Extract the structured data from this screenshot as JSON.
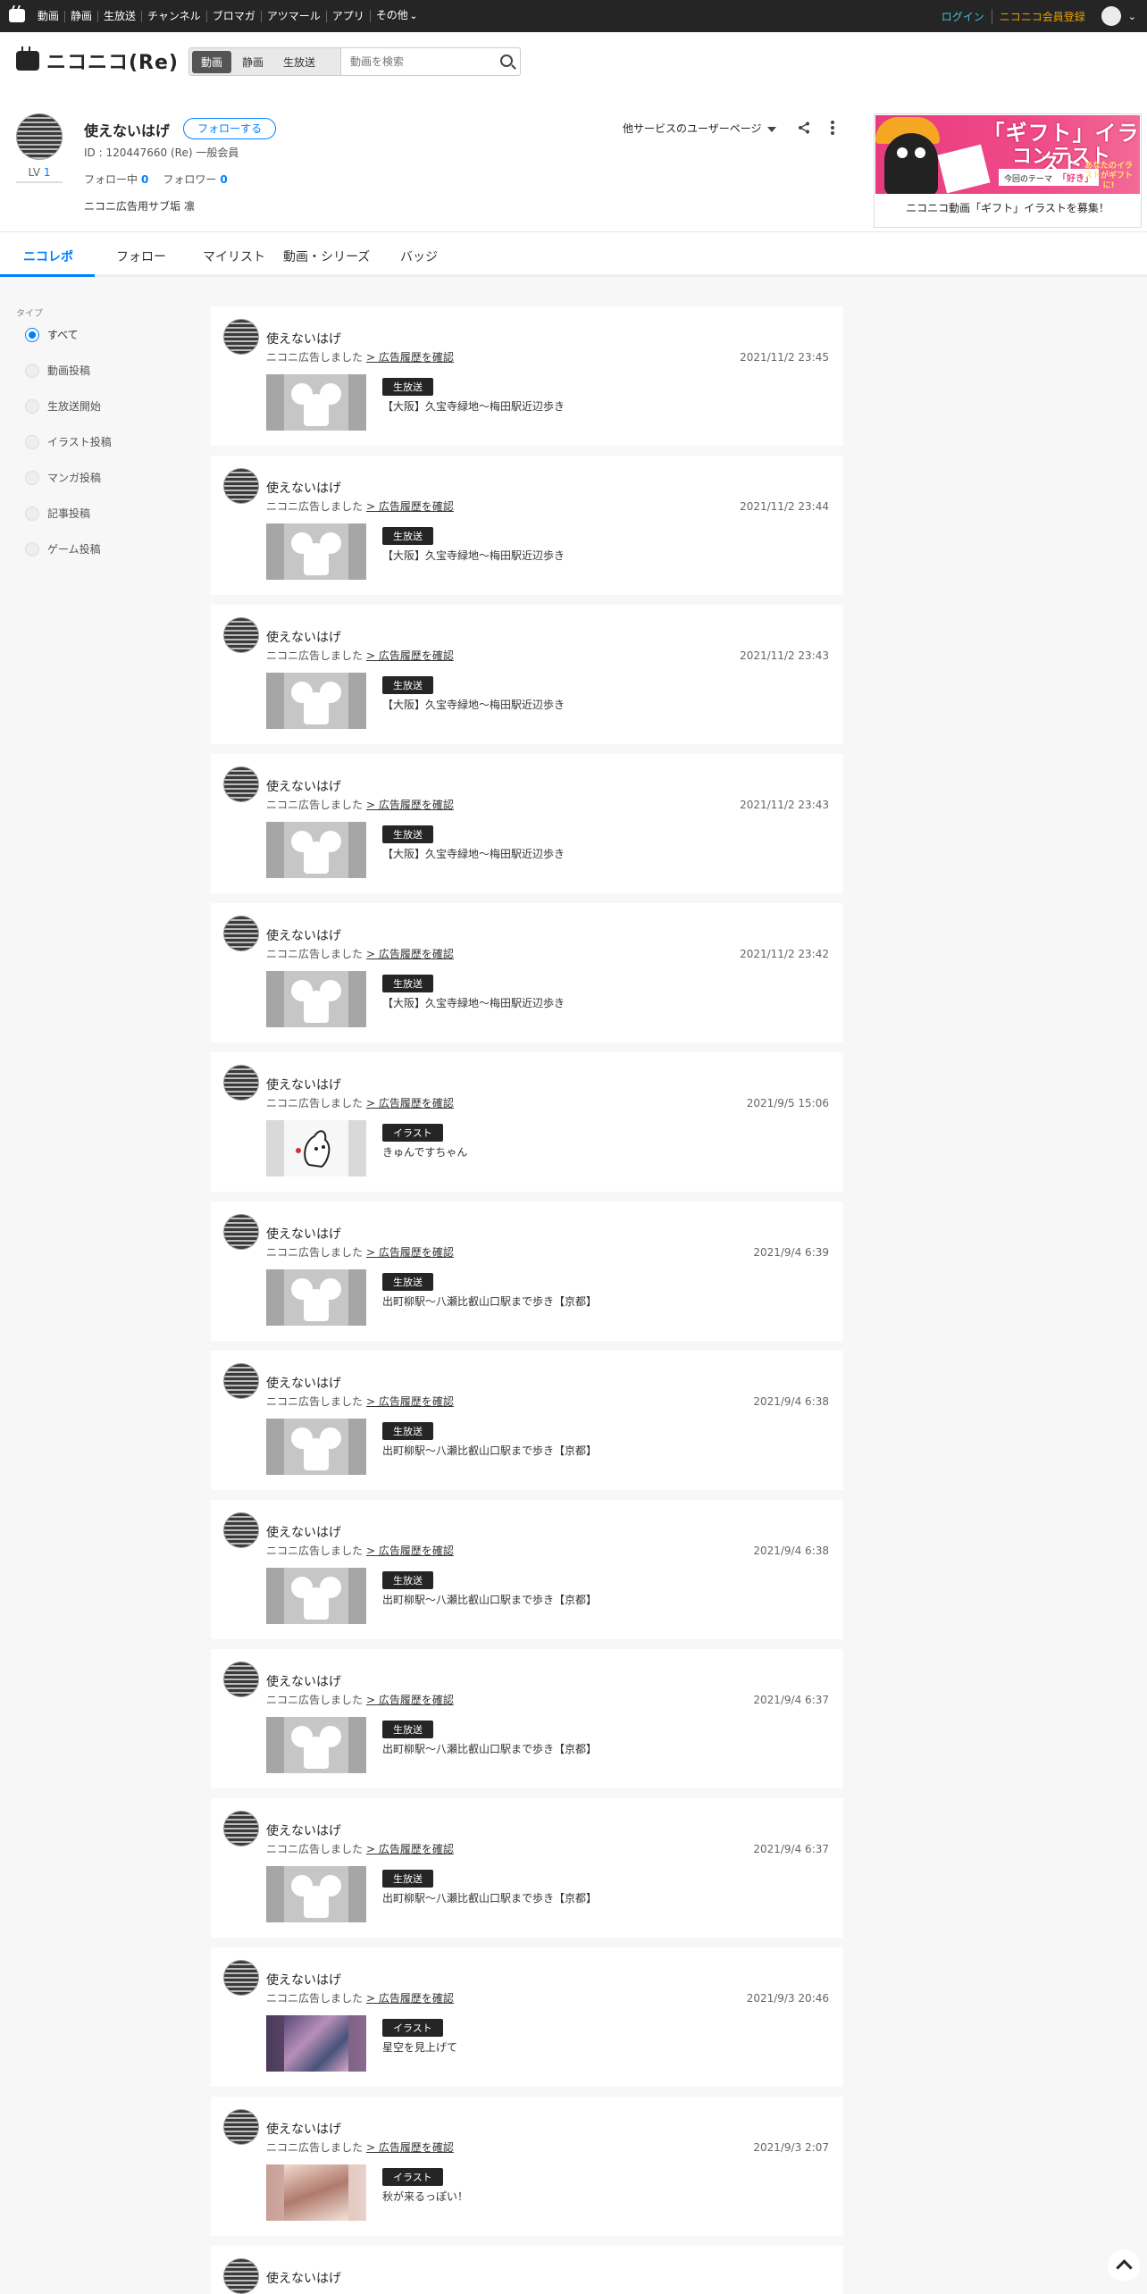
{
  "topnav": {
    "items": [
      "動画",
      "静画",
      "生放送",
      "チャンネル",
      "ブロマガ",
      "アツマール",
      "アプリ",
      "その他"
    ],
    "login": "ログイン",
    "register": "ニコニコ会員登録"
  },
  "header": {
    "logo_text": "ニコニコ(Re)",
    "search_tabs": [
      "動画",
      "静画",
      "生放送"
    ],
    "search_placeholder": "動画を検索"
  },
  "profile": {
    "name": "使えないはげ",
    "follow_button": "フォローする",
    "id_line": "ID : 120447660 (Re) 一般会員",
    "level_label": "LV",
    "level": "1",
    "following_label": "フォロー中",
    "following": "0",
    "followers_label": "フォロワー",
    "followers": "0",
    "description": "ニコニ広告用サブ垢 凛",
    "other_services": "他サービスのユーザーページ"
  },
  "ad": {
    "title_line1": "「ギフト」イラスト",
    "title_line2": "コンテスト",
    "theme_label": "今回のテーマ",
    "theme": "「好き」",
    "side_text": "あなたのイラストがギフトに!",
    "caption": "ニコニコ動画「ギフト」イラストを募集！"
  },
  "tabs": [
    "ニコレポ",
    "フォロー",
    "マイリスト",
    "動画・シリーズ",
    "バッジ"
  ],
  "sidebar": {
    "title": "タイプ",
    "filters": [
      "すべて",
      "動画投稿",
      "生放送開始",
      "イラスト投稿",
      "マンガ投稿",
      "記事投稿",
      "ゲーム投稿"
    ]
  },
  "feed": {
    "action_text": "ニコニ広告しました",
    "link_text": "> 広告履歴を確認",
    "items": [
      {
        "user": "使えないはげ",
        "date": "2021/11/2 23:45",
        "tag": "生放送",
        "title": "【大阪】久宝寺緑地～梅田駅近辺歩き"
      },
      {
        "user": "使えないはげ",
        "date": "2021/11/2 23:44",
        "tag": "生放送",
        "title": "【大阪】久宝寺緑地～梅田駅近辺歩き"
      },
      {
        "user": "使えないはげ",
        "date": "2021/11/2 23:43",
        "tag": "生放送",
        "title": "【大阪】久宝寺緑地～梅田駅近辺歩き"
      },
      {
        "user": "使えないはげ",
        "date": "2021/11/2 23:43",
        "tag": "生放送",
        "title": "【大阪】久宝寺緑地～梅田駅近辺歩き"
      },
      {
        "user": "使えないはげ",
        "date": "2021/11/2 23:42",
        "tag": "生放送",
        "title": "【大阪】久宝寺緑地～梅田駅近辺歩き"
      },
      {
        "user": "使えないはげ",
        "date": "2021/9/5 15:06",
        "tag": "イラスト",
        "title": "きゅんですちゃん"
      },
      {
        "user": "使えないはげ",
        "date": "2021/9/4 6:39",
        "tag": "生放送",
        "title": "出町柳駅～八瀬比叡山口駅まで歩き【京都】"
      },
      {
        "user": "使えないはげ",
        "date": "2021/9/4 6:38",
        "tag": "生放送",
        "title": "出町柳駅～八瀬比叡山口駅まで歩き【京都】"
      },
      {
        "user": "使えないはげ",
        "date": "2021/9/4 6:38",
        "tag": "生放送",
        "title": "出町柳駅～八瀬比叡山口駅まで歩き【京都】"
      },
      {
        "user": "使えないはげ",
        "date": "2021/9/4 6:37",
        "tag": "生放送",
        "title": "出町柳駅～八瀬比叡山口駅まで歩き【京都】"
      },
      {
        "user": "使えないはげ",
        "date": "2021/9/4 6:37",
        "tag": "生放送",
        "title": "出町柳駅～八瀬比叡山口駅まで歩き【京都】"
      },
      {
        "user": "使えないはげ",
        "date": "2021/9/3 20:46",
        "tag": "イラスト",
        "title": "星空を見上げて"
      },
      {
        "user": "使えないはげ",
        "date": "2021/9/3 2:07",
        "tag": "イラスト",
        "title": "秋が来るっぽい！"
      }
    ],
    "partial_user": "使えないはげ"
  }
}
